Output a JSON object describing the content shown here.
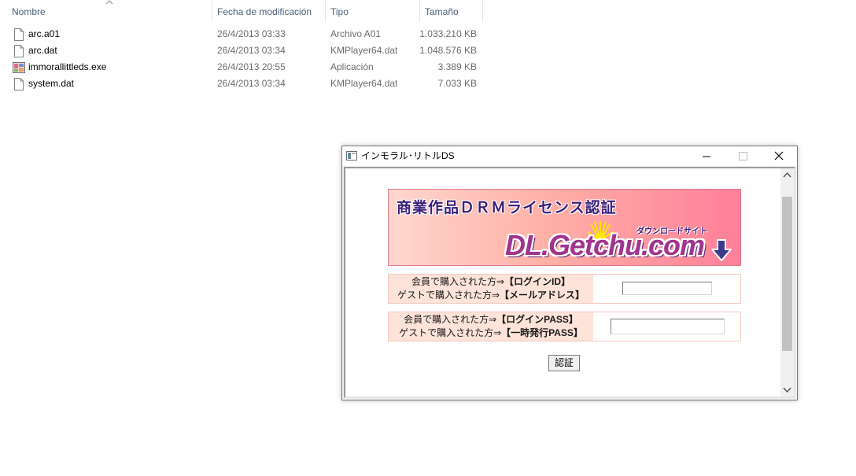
{
  "explorer": {
    "columns": {
      "name": "Nombre",
      "modified": "Fecha de modificación",
      "type": "Tipo",
      "size": "Tamaño"
    },
    "files": [
      {
        "name": "arc.a01",
        "modified": "26/4/2013 03:33",
        "type": "Archivo A01",
        "size": "1.033.210 KB",
        "icon": "blank-file-icon"
      },
      {
        "name": "arc.dat",
        "modified": "26/4/2013 03:34",
        "type": "KMPlayer64.dat",
        "size": "1.048.576 KB",
        "icon": "blank-file-icon"
      },
      {
        "name": "immorallittleds.exe",
        "modified": "26/4/2013 20:55",
        "type": "Aplicación",
        "size": "3.389 KB",
        "icon": "app-exe-icon"
      },
      {
        "name": "system.dat",
        "modified": "26/4/2013 03:34",
        "type": "KMPlayer64.dat",
        "size": "7.033 KB",
        "icon": "blank-file-icon"
      }
    ]
  },
  "dialog": {
    "title": "インモラル･リトルDS",
    "banner": {
      "heading": "商業作品ＤＲＭライセンス認証",
      "subtitle": "ダウンロードサイト",
      "logo": "DL.Getchu.com"
    },
    "login_id": {
      "member_label": "会員で購入された方⇒",
      "member_target": "【ログインID】",
      "guest_label": "ゲストで購入された方⇒",
      "guest_target": "【メールアドレス】",
      "value": ""
    },
    "login_pass": {
      "member_label": "会員で購入された方⇒",
      "member_target": "【ログインPASS】",
      "guest_label": "ゲストで購入された方⇒",
      "guest_target": "【一時発行PASS】",
      "value": ""
    },
    "auth_button": "認証"
  },
  "colors": {
    "header_text": "#4c607a",
    "banner_text": "#3b1f7a",
    "logo": "#a0348f",
    "label_bg": "#fde3da"
  }
}
